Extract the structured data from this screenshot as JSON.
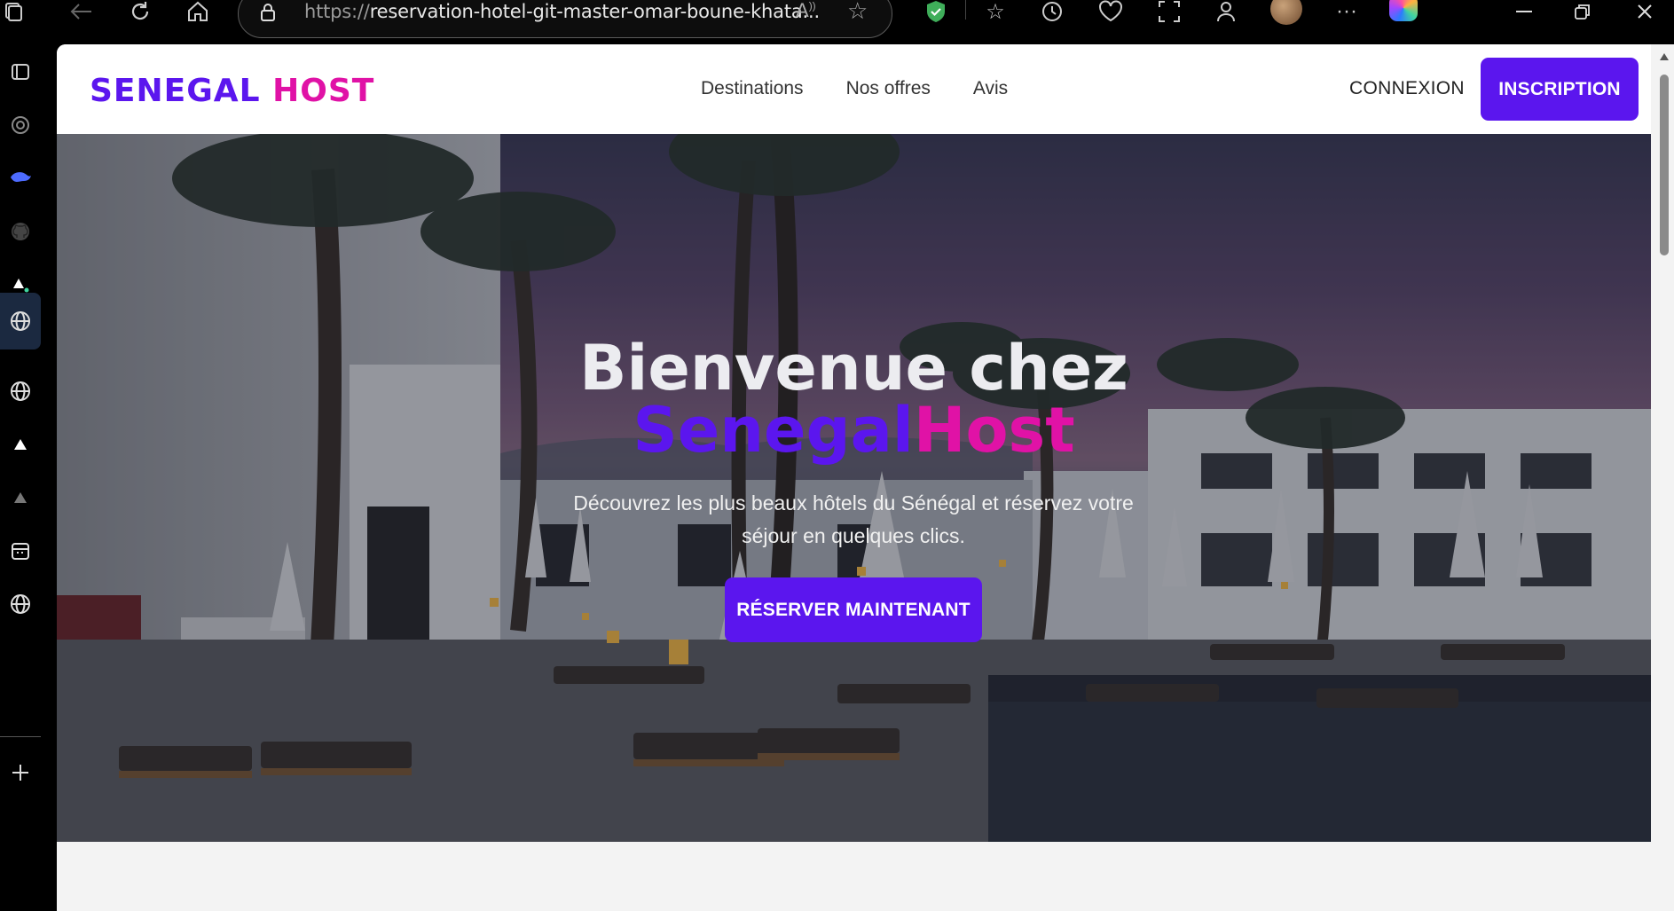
{
  "browser": {
    "url_prefix": "https://",
    "url_host": "reservation-hotel-git-master-omar-boune-khata...",
    "icons": {
      "back": "back-arrow-icon",
      "reload": "reload-icon",
      "home": "home-icon",
      "lock": "lock-icon",
      "read_aloud": "read-aloud-icon",
      "favorite": "star-icon",
      "shield": "shield-check-icon",
      "favorites": "favorites-icon",
      "history": "history-icon",
      "health": "browser-essentials-icon",
      "screenshot": "screenshot-icon",
      "extensions": "extensions-icon",
      "profile": "profile-avatar",
      "more": "more-icon",
      "copilot": "copilot-icon",
      "minimize": "minimize-icon",
      "restore": "restore-icon",
      "close": "close-icon"
    }
  },
  "sidebar": {
    "items": [
      {
        "icon": "tab-actions-icon"
      },
      {
        "icon": "chatgpt-icon"
      },
      {
        "icon": "deepseek-icon"
      },
      {
        "icon": "github-icon"
      },
      {
        "icon": "vercel-icon"
      },
      {
        "icon": "globe-icon"
      },
      {
        "icon": "globe-icon"
      },
      {
        "icon": "triangle-icon"
      },
      {
        "icon": "triangle-icon"
      },
      {
        "icon": "calendar-icon"
      },
      {
        "icon": "globe-icon"
      },
      {
        "icon": "plus-icon"
      }
    ]
  },
  "site": {
    "logo": {
      "part1": "SENEGAL",
      "part2": "HOST"
    },
    "nav": {
      "links": [
        "Destinations",
        "Nos offres",
        "Avis"
      ],
      "login": "CONNEXION",
      "signup": "INSCRIPTION"
    },
    "hero": {
      "title": "Bienvenue chez",
      "brand_part1": "Senegal",
      "brand_part2": "Host",
      "subtitle": "Découvrez les plus beaux hôtels du Sénégal et réservez votre séjour en quelques clics.",
      "cta": "RÉSERVER MAINTENANT"
    }
  },
  "colors": {
    "brand_primary": "#5b16ee",
    "brand_secondary": "#e012a6"
  }
}
